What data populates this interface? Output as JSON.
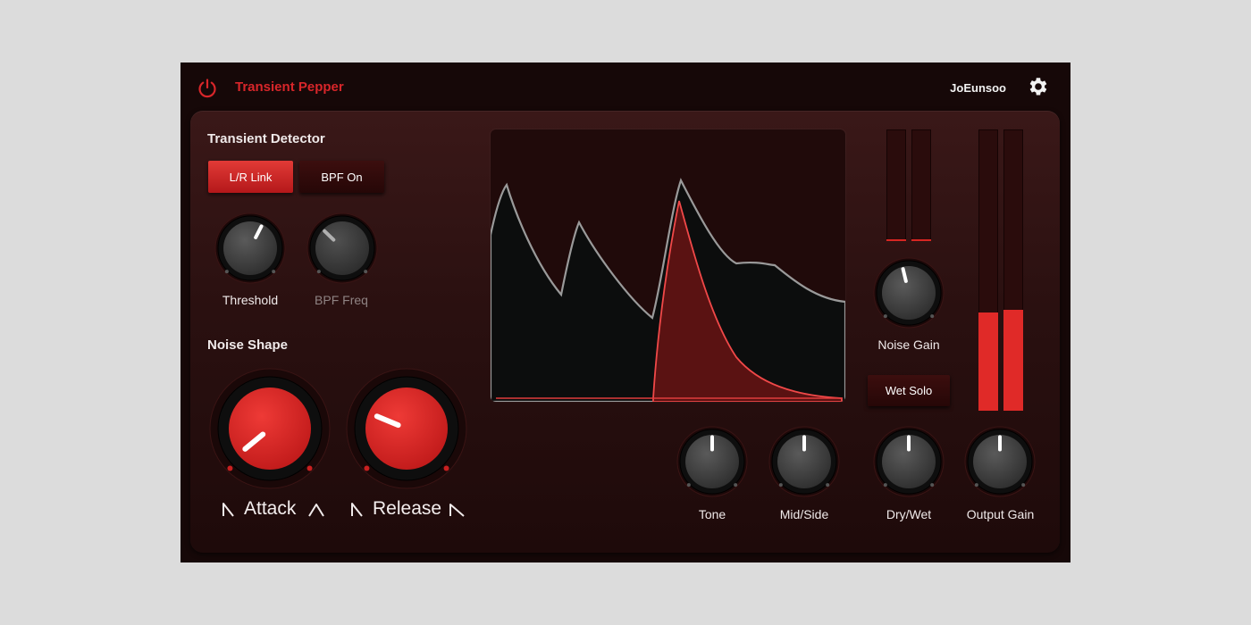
{
  "header": {
    "title": "Transient Pepper",
    "user": "JoEunsoo",
    "power_icon": "power-icon",
    "settings_icon": "gear-icon"
  },
  "colors": {
    "accent": "#d8262a",
    "background": "#160808",
    "panel": "#2a1010",
    "knob_red": "#d42424",
    "knob_dark": "#3a3a3a"
  },
  "transient_detector": {
    "title": "Transient Detector",
    "lr_link": {
      "label": "L/R Link",
      "active": true
    },
    "bpf_on": {
      "label": "BPF On",
      "active": false
    },
    "threshold": {
      "label": "Threshold",
      "value": 0.6
    },
    "bpf_freq": {
      "label": "BPF Freq",
      "value": 0.33,
      "disabled": true
    }
  },
  "noise_shape": {
    "title": "Noise Shape",
    "attack": {
      "label": "Attack",
      "value": 0.02
    },
    "release": {
      "label": "Release",
      "value": 0.25
    }
  },
  "mixer": {
    "noise_gain": {
      "label": "Noise Gain",
      "value": 0.45
    },
    "wet_solo": {
      "label": "Wet Solo",
      "active": false
    },
    "tone": {
      "label": "Tone",
      "value": 0.5
    },
    "mid_side": {
      "label": "Mid/Side",
      "value": 0.5
    },
    "dry_wet": {
      "label": "Dry/Wet",
      "value": 0.5
    },
    "output_gain": {
      "label": "Output Gain",
      "value": 0.5
    }
  },
  "meters": {
    "noise_meter_levels": [
      0.0,
      0.0
    ],
    "output_meter_levels": [
      0.35,
      0.36
    ]
  }
}
